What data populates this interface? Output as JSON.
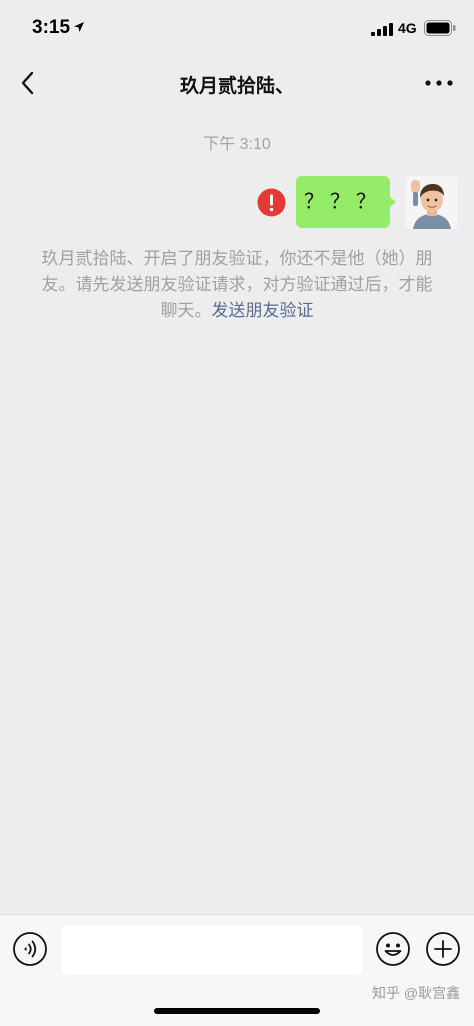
{
  "status_bar": {
    "time": "3:15",
    "network": "4G"
  },
  "nav": {
    "title": "玖月贰拾陆、",
    "back_icon": "chevron-left-icon",
    "more_icon": "ellipsis-icon"
  },
  "chat": {
    "timestamp": "下午 3:10",
    "message": {
      "text": "？？？",
      "status_icon": "send-failed-icon",
      "bubble_color": "#95ec69"
    },
    "system_notice": {
      "text": "玖月贰拾陆、开启了朋友验证，你还不是他（她）朋友。请先发送朋友验证请求，对方验证通过后，才能聊天。",
      "link_text": "发送朋友验证",
      "link_color": "#576b95"
    }
  },
  "input_bar": {
    "text_value": "",
    "voice_icon": "voice-icon",
    "emoji_icon": "emoji-icon",
    "plus_icon": "plus-icon"
  },
  "watermark": "知乎 @耿宫鑫",
  "colors": {
    "background": "#ededed",
    "alert_red": "#e53935"
  }
}
